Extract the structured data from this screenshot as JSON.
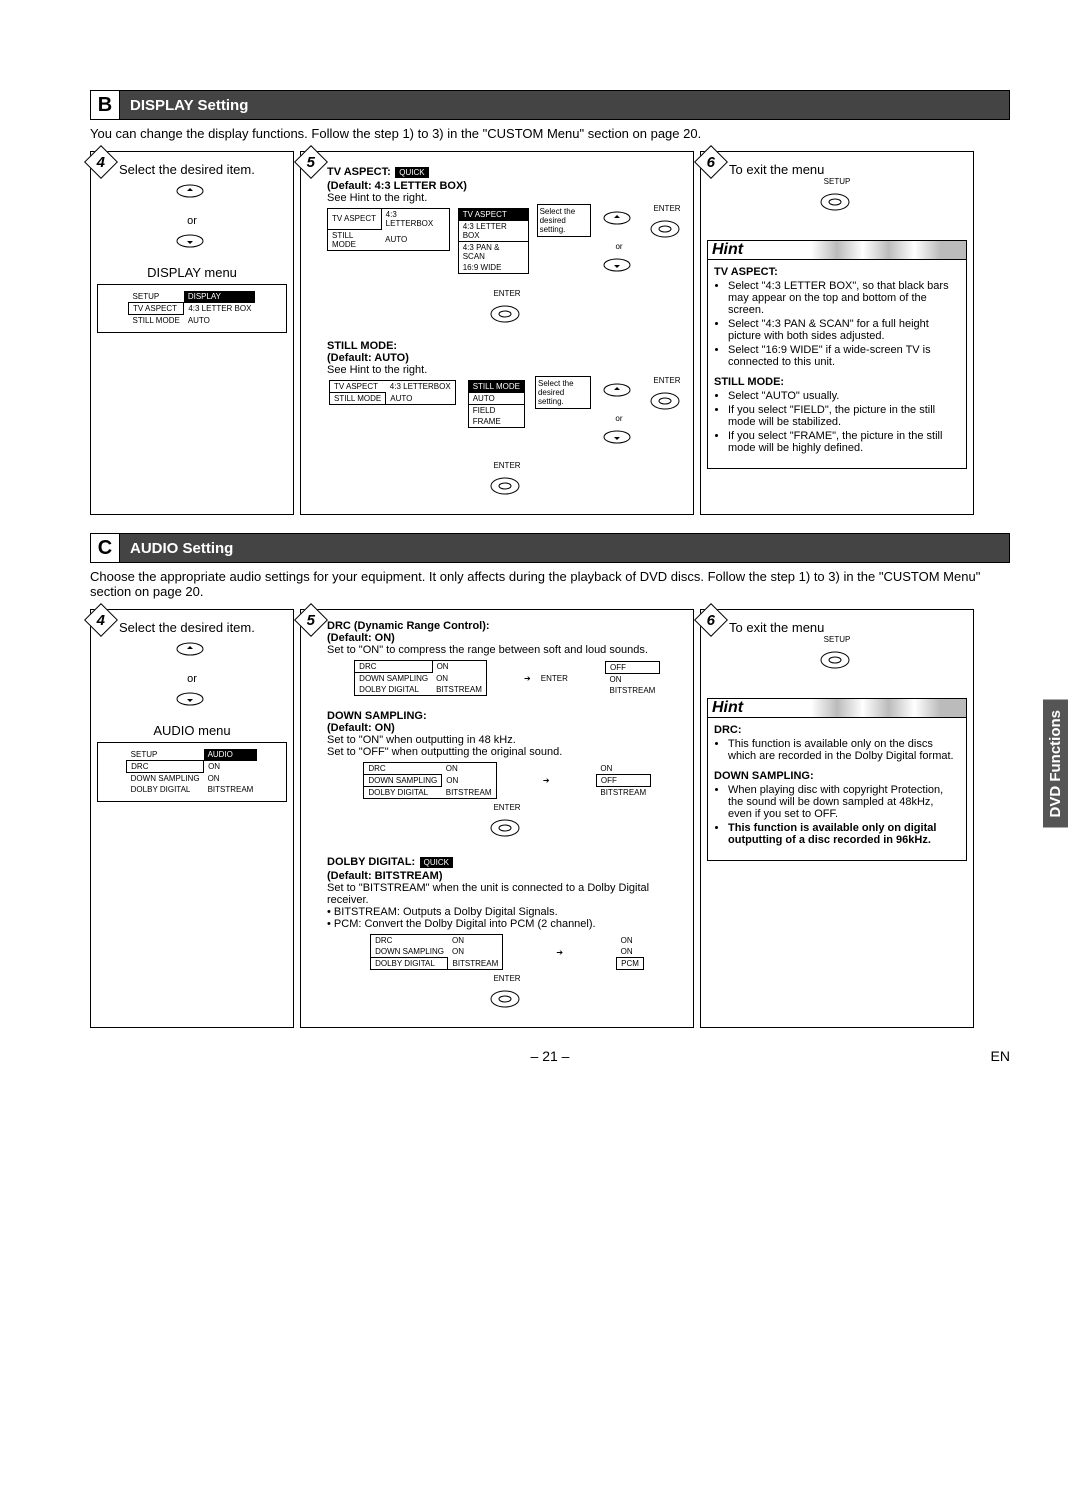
{
  "sectionB": {
    "letter": "B",
    "title": "DISPLAY Setting",
    "intro": "You can change the display functions. Follow the step 1) to 3) in the \"CUSTOM Menu\" section on page 20.",
    "step4": {
      "title": "Select the desired item.",
      "or": "or",
      "menuTitle": "DISPLAY menu",
      "setup": "SETUP",
      "tab": "DISPLAY",
      "rows": [
        {
          "k": "TV ASPECT",
          "v": "4:3 LETTER BOX"
        },
        {
          "k": "STILL MODE",
          "v": "AUTO"
        }
      ]
    },
    "step5": {
      "tvaspect": {
        "head": "TV ASPECT:",
        "quick": "QUICK",
        "default": "(Default: 4:3 LETTER BOX)",
        "see": "See Hint to the right.",
        "rows": [
          {
            "k": "TV ASPECT",
            "v": "4:3 LETTERBOX"
          },
          {
            "k": "STILL MODE",
            "v": "AUTO"
          }
        ],
        "submenuTitle": "TV ASPECT",
        "subrows": [
          "4:3 LETTER BOX",
          "4:3 PAN & SCAN",
          "16:9 WIDE"
        ],
        "selectText": "Select the desired setting.",
        "enter": "ENTER",
        "or": "or"
      },
      "stillmode": {
        "head": "STILL MODE:",
        "default": "(Default: AUTO)",
        "see": "See Hint to the right.",
        "rows": [
          {
            "k": "TV ASPECT",
            "v": "4:3 LETTERBOX"
          },
          {
            "k": "STILL MODE",
            "v": "AUTO"
          }
        ],
        "submenuTitle": "STILL MODE",
        "subrows": [
          "AUTO",
          "FIELD",
          "FRAME"
        ],
        "selectText": "Select the desired setting.",
        "enter": "ENTER",
        "or": "or"
      }
    },
    "step6": {
      "title": "To exit the menu",
      "setup": "SETUP",
      "hintTitle": "Hint",
      "hints": {
        "tvaspectTitle": "TV ASPECT:",
        "tvaspect": [
          "Select \"4:3 LETTER BOX\", so that black bars may appear on the top and bottom of the screen.",
          "Select \"4:3 PAN & SCAN\" for a full height picture with both sides adjusted.",
          "Select \"16:9 WIDE\" if a wide-screen TV is connected to this unit."
        ],
        "stillTitle": "STILL MODE:",
        "still": [
          "Select \"AUTO\" usually.",
          "If you select \"FIELD\", the picture in the still mode will be stabilized.",
          "If you select \"FRAME\", the picture in the still mode will be highly defined."
        ]
      }
    }
  },
  "sectionC": {
    "letter": "C",
    "title": "AUDIO Setting",
    "intro": "Choose the appropriate audio settings for your equipment. It only affects during the playback of DVD discs. Follow the step 1) to 3) in the \"CUSTOM Menu\" section on page 20.",
    "step4": {
      "title": "Select the desired item.",
      "or": "or",
      "menuTitle": "AUDIO menu",
      "setup": "SETUP",
      "tab": "AUDIO",
      "rows": [
        {
          "k": "DRC",
          "v": "ON"
        },
        {
          "k": "DOWN SAMPLING",
          "v": "ON"
        },
        {
          "k": "DOLBY DIGITAL",
          "v": "BITSTREAM"
        }
      ]
    },
    "step5": {
      "drc": {
        "head": "DRC (Dynamic Range Control):",
        "default": "(Default: ON)",
        "desc": "Set to \"ON\" to compress the range between soft and loud sounds.",
        "rows": [
          {
            "k": "DRC",
            "v": "ON"
          },
          {
            "k": "DOWN SAMPLING",
            "v": "ON"
          },
          {
            "k": "DOLBY DIGITAL",
            "v": "BITSTREAM"
          }
        ],
        "optrows": [
          "OFF",
          "ON",
          "BITSTREAM"
        ],
        "enter": "ENTER"
      },
      "down": {
        "head": "DOWN SAMPLING:",
        "default": "(Default: ON)",
        "desc1": "Set to \"ON\" when outputting in 48 kHz.",
        "desc2": "Set to \"OFF\" when outputting the original sound.",
        "rows": [
          {
            "k": "DRC",
            "v": "ON"
          },
          {
            "k": "DOWN SAMPLING",
            "v": "ON"
          },
          {
            "k": "DOLBY DIGITAL",
            "v": "BITSTREAM"
          }
        ],
        "optrows": [
          "ON",
          "OFF",
          "BITSTREAM"
        ],
        "enter": "ENTER"
      },
      "dolby": {
        "head": "DOLBY DIGITAL:",
        "quick": "QUICK",
        "default": "(Default: BITSTREAM)",
        "desc": "Set to \"BITSTREAM\" when the unit is connected to a Dolby Digital receiver.",
        "b1": "BITSTREAM: Outputs a Dolby Digital Signals.",
        "b2": "PCM: Convert the Dolby Digital into PCM (2 channel).",
        "rows": [
          {
            "k": "DRC",
            "v": "ON"
          },
          {
            "k": "DOWN SAMPLING",
            "v": "ON"
          },
          {
            "k": "DOLBY DIGITAL",
            "v": "BITSTREAM"
          }
        ],
        "optrows": [
          "ON",
          "ON",
          "PCM"
        ],
        "enter": "ENTER"
      }
    },
    "step6": {
      "title": "To exit the menu",
      "setup": "SETUP",
      "hintTitle": "Hint",
      "hints": {
        "drcTitle": "DRC:",
        "drc": [
          "This function is available only on the discs which are recorded in the Dolby Digital format."
        ],
        "downTitle": "DOWN SAMPLING:",
        "down": [
          "When playing disc with copyright Protection, the sound will be down sampled at 48kHz, even if you set to OFF."
        ],
        "bold": "This function is available only on digital outputting of a disc recorded in 96kHz."
      }
    }
  },
  "sideTab": "DVD Functions",
  "pageNum": "– 21 –",
  "en": "EN"
}
